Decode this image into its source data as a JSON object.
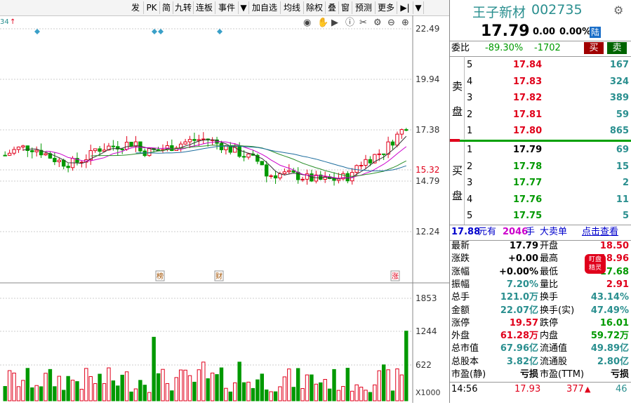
{
  "toolbar": {
    "buttons": [
      "发",
      "PK",
      "简",
      "九转",
      "连板",
      "事件",
      "▼",
      "加自选",
      "均线",
      "除权",
      "叠",
      "窗",
      "预测",
      "更多",
      "▶|",
      "▼"
    ]
  },
  "chart": {
    "top_left_label": "34",
    "price_axis": [
      "22.49",
      "19.94",
      "17.38",
      "15.32",
      "14.79",
      "12.24"
    ],
    "volume_axis": [
      "1853",
      "1244",
      "622"
    ],
    "volume_unit": "X1000",
    "markers": [
      "榜",
      "财",
      "涨"
    ],
    "colors": {
      "up": "#e0001b",
      "down": "#009900",
      "bg": "#ffffff"
    }
  },
  "quote": {
    "name": "王子新材",
    "code": "002735",
    "price": "17.79",
    "change": "0.00",
    "change_pct": "0.00%",
    "market_tag": "陆",
    "weibi_label": "委比",
    "weibi": "-89.30%",
    "weicha": "-1702",
    "buy_btn": "买",
    "sell_btn": "卖",
    "sell_label_1": "卖",
    "sell_label_2": "盘",
    "buy_label_1": "买",
    "buy_label_2": "盘",
    "sell_levels": [
      {
        "lvl": "5",
        "price": "17.84",
        "vol": "167"
      },
      {
        "lvl": "4",
        "price": "17.83",
        "vol": "324"
      },
      {
        "lvl": "3",
        "price": "17.82",
        "vol": "389"
      },
      {
        "lvl": "2",
        "price": "17.81",
        "vol": "59"
      },
      {
        "lvl": "1",
        "price": "17.80",
        "vol": "865"
      }
    ],
    "buy_levels": [
      {
        "lvl": "1",
        "price": "17.79",
        "vol": "69"
      },
      {
        "lvl": "2",
        "price": "17.78",
        "vol": "15"
      },
      {
        "lvl": "3",
        "price": "17.77",
        "vol": "2"
      },
      {
        "lvl": "4",
        "price": "17.76",
        "vol": "11"
      },
      {
        "lvl": "5",
        "price": "17.75",
        "vol": "5"
      }
    ],
    "bigorder": {
      "price": "17.88",
      "unit1": "元有",
      "qty": "2046",
      "unit2": "手",
      "text": "大卖单",
      "link": "点击查看"
    },
    "stats": [
      {
        "k1": "最新",
        "v1": "17.79",
        "k2": "开盘",
        "v2": "18.50",
        "c1": "black",
        "c2": "red"
      },
      {
        "k1": "涨跌",
        "v1": "+0.00",
        "k2": "最高",
        "v2": "18.96",
        "c1": "black",
        "c2": "red"
      },
      {
        "k1": "涨幅",
        "v1": "+0.00%",
        "k2": "最低",
        "v2": "17.68",
        "c1": "black",
        "c2": "green"
      },
      {
        "k1": "振幅",
        "v1": "7.20%",
        "k2": "量比",
        "v2": "2.91",
        "c1": "teal",
        "c2": "red"
      },
      {
        "k1": "总手",
        "v1": "121.0万",
        "k2": "换手",
        "v2": "43.14%",
        "c1": "teal",
        "c2": "teal"
      },
      {
        "k1": "金额",
        "v1": "22.07亿",
        "k2": "换手(实)",
        "v2": "47.49%",
        "c1": "teal",
        "c2": "teal"
      },
      {
        "k1": "涨停",
        "v1": "19.57",
        "k2": "跌停",
        "v2": "16.01",
        "c1": "red",
        "c2": "green"
      },
      {
        "k1": "外盘",
        "v1": "61.28万",
        "k2": "内盘",
        "v2": "59.72万",
        "c1": "red",
        "c2": "green"
      },
      {
        "k1": "总市值",
        "v1": "67.96亿",
        "k2": "流通值",
        "v2": "49.89亿",
        "c1": "teal",
        "c2": "teal"
      },
      {
        "k1": "总股本",
        "v1": "3.82亿",
        "k2": "流通股",
        "v2": "2.80亿",
        "c1": "teal",
        "c2": "teal"
      },
      {
        "k1": "市盈(静)",
        "v1": "亏损",
        "k2": "市盈(TTM)",
        "v2": "亏损",
        "c1": "black",
        "c2": "black"
      }
    ],
    "badge": {
      "line1": "盯盘",
      "line2": "精灵"
    },
    "tick": {
      "time": "14:56",
      "price": "17.93",
      "vol": "377",
      "extra": "46"
    }
  }
}
